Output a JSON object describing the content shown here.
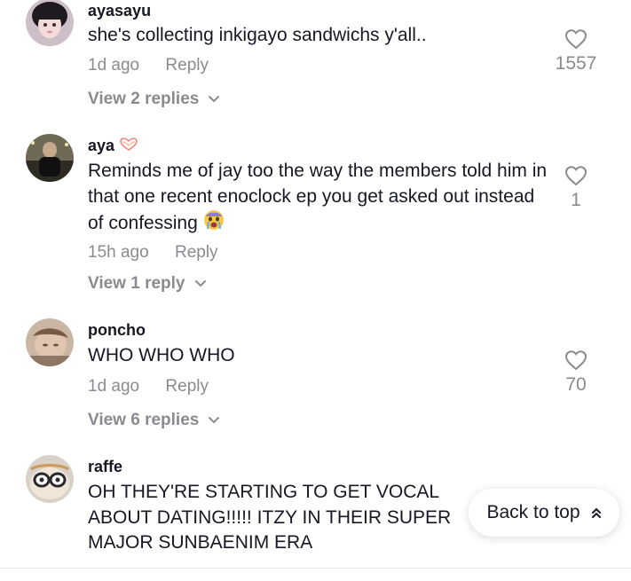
{
  "comments": [
    {
      "username": "ayasayu",
      "text": "she's collecting inkigayo sandwichs y'all..",
      "time": "1d ago",
      "reply_label": "Reply",
      "likes": "1557",
      "view_replies": "View 2 replies"
    },
    {
      "username": "aya",
      "username_emoji": "hand-heart-icon",
      "text": "Reminds me of jay too the way the members told him in that one recent enoclock ep you get asked out instead of confessing",
      "text_emoji": "crying-face-icon",
      "time": "15h ago",
      "reply_label": "Reply",
      "likes": "1",
      "view_replies": "View 1 reply"
    },
    {
      "username": "poncho",
      "text": "WHO WHO WHO",
      "time": "1d ago",
      "reply_label": "Reply",
      "likes": "70",
      "view_replies": "View 6 replies"
    },
    {
      "username": "raffe",
      "text": "OH THEY'RE STARTING TO GET VOCAL ABOUT DATING!!!!! ITZY IN THEIR SUPER MAJOR SUNBAENIM ERA"
    }
  ],
  "back_to_top": {
    "label": "Back to top",
    "icon": "double-chevron-up-icon"
  },
  "colors": {
    "primary_text": "#161823",
    "secondary_text": "#8a8b91",
    "background": "#ffffff"
  }
}
